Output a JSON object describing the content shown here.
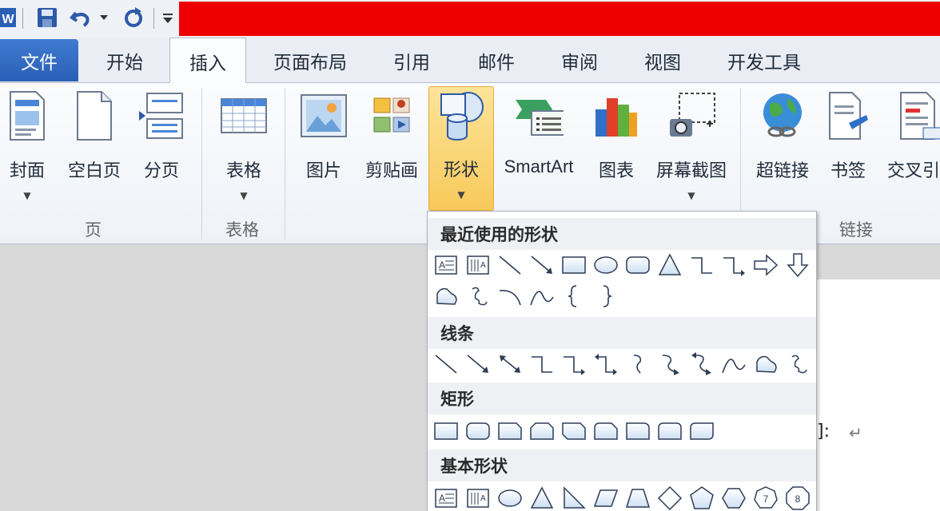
{
  "colors": {
    "accent_blue": "#2a5fb6",
    "pressed_button": "#f8c95a",
    "red_bar": "#ee0000"
  },
  "qat": {
    "app_icon": "W"
  },
  "tabs": [
    "文件",
    "开始",
    "插入",
    "页面布局",
    "引用",
    "邮件",
    "审阅",
    "视图",
    "开发工具"
  ],
  "ribbon": {
    "buttons": {
      "cover": "封面",
      "blank": "空白页",
      "pagebreak": "分页",
      "table": "表格",
      "picture": "图片",
      "clipart": "剪贴画",
      "shapes": "形状",
      "smartart": "SmartArt",
      "chart": "图表",
      "screenshot": "屏幕截图",
      "hyperlink": "超链接",
      "bookmark": "书签",
      "crossref": "交叉引"
    },
    "groups": {
      "pages": "页",
      "tables": "表格",
      "links": "链接"
    }
  },
  "document": {
    "tail_text": "]:",
    "return_mark": "↵"
  },
  "dropdown": {
    "sections": [
      "最近使用的形状",
      "线条",
      "矩形",
      "基本形状"
    ],
    "recent": [
      "text-box",
      "vertical-text-box",
      "line",
      "arrow-line",
      "rectangle",
      "oval",
      "rounded-rectangle",
      "triangle",
      "elbow-connector",
      "elbow-arrow-connector",
      "right-arrow",
      "down-arrow",
      "freeform",
      "scribble",
      "arc",
      "curve",
      "left-brace",
      "right-brace"
    ],
    "lines": [
      "line",
      "arrow",
      "double-arrow",
      "elbow-connector",
      "elbow-arrow",
      "elbow-double-arrow",
      "curved-connector",
      "curved-arrow",
      "curved-double-arrow",
      "curve",
      "freeform",
      "scribble"
    ],
    "rectangles": [
      "rectangle",
      "rounded-rectangle",
      "snip-single-corner",
      "snip-same-side",
      "snip-diagonal",
      "snip-round",
      "round-single-corner",
      "round-same-side",
      "round-diagonal"
    ],
    "basic": [
      "text-box",
      "vertical-text-box",
      "oval",
      "triangle",
      "right-triangle",
      "parallelogram",
      "trapezoid",
      "diamond",
      "pentagon",
      "hexagon",
      "heptagon",
      "octagon"
    ],
    "heptagon_label": "7",
    "octagon_label": "8"
  }
}
